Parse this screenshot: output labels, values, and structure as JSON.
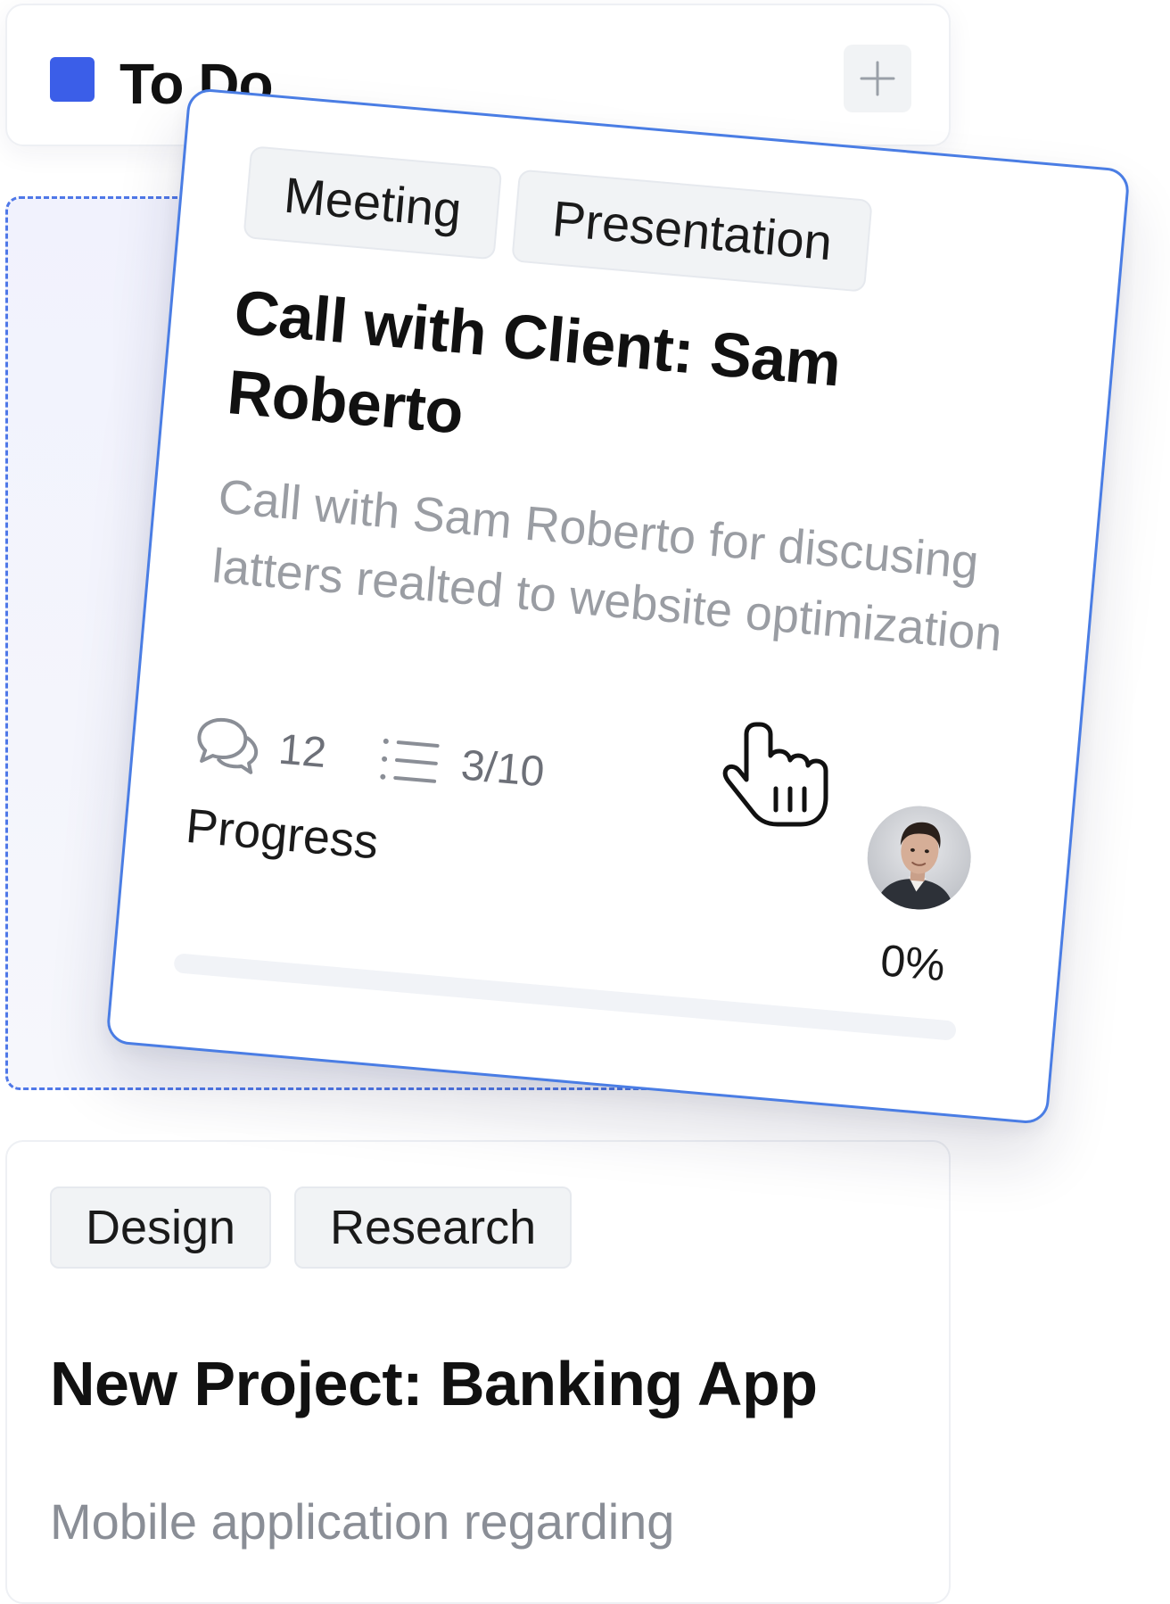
{
  "column": {
    "title": "To Do",
    "accent_color": "#3b5ee8",
    "add_icon": "plus-icon"
  },
  "dragged_card": {
    "tags": [
      "Meeting",
      "Presentation"
    ],
    "title": "Call with Client: Sam Roberto",
    "description": "Call with Sam Roberto for discusing latters realted to website optimization",
    "comments_count": "12",
    "comments_icon": "comments-icon",
    "checklist": "3/10",
    "checklist_icon": "checklist-icon",
    "progress_label": "Progress",
    "progress_percent_text": "0%",
    "progress_value": 0,
    "assignee_icon": "avatar",
    "border_color": "#4a7de4"
  },
  "second_card": {
    "tags": [
      "Design",
      "Research"
    ],
    "title": "New Project: Banking App",
    "description": "Mobile application regarding"
  },
  "cursor_icon": "hand-pointer-icon"
}
